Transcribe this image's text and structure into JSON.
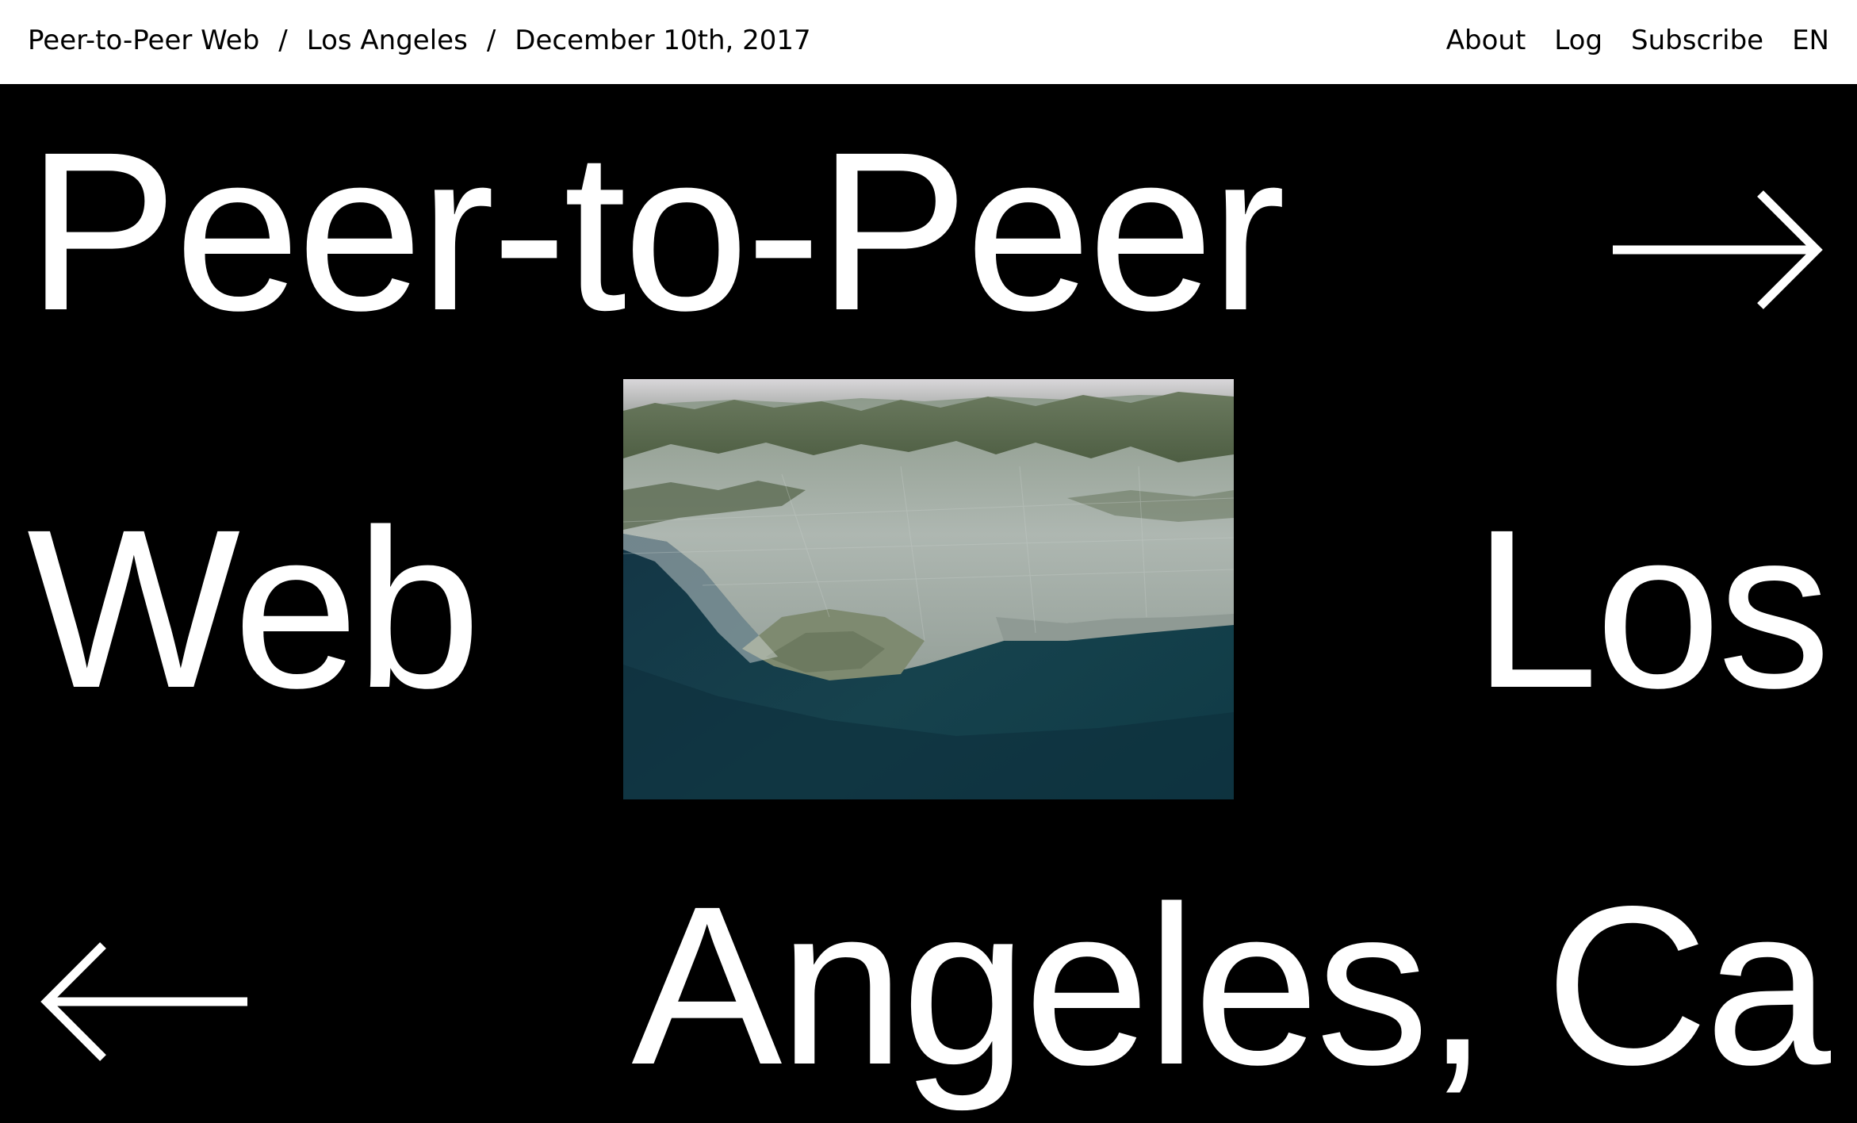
{
  "header": {
    "breadcrumb": [
      "Peer-to-Peer Web",
      "Los Angeles",
      "December 10th, 2017"
    ],
    "separator": "/",
    "nav": [
      "About",
      "Log",
      "Subscribe",
      "EN"
    ]
  },
  "hero": {
    "line1": "Peer-to-Peer",
    "line2_left": "Web",
    "line2_right": "Los",
    "line3": "Angeles, Ca",
    "next_icon": "arrow-right-icon",
    "prev_icon": "arrow-left-icon",
    "image": "aerial-satellite-photo-los-angeles"
  },
  "colors": {
    "background": "#000000",
    "header_bg": "#ffffff",
    "text_light": "#ffffff",
    "text_dark": "#000000"
  }
}
